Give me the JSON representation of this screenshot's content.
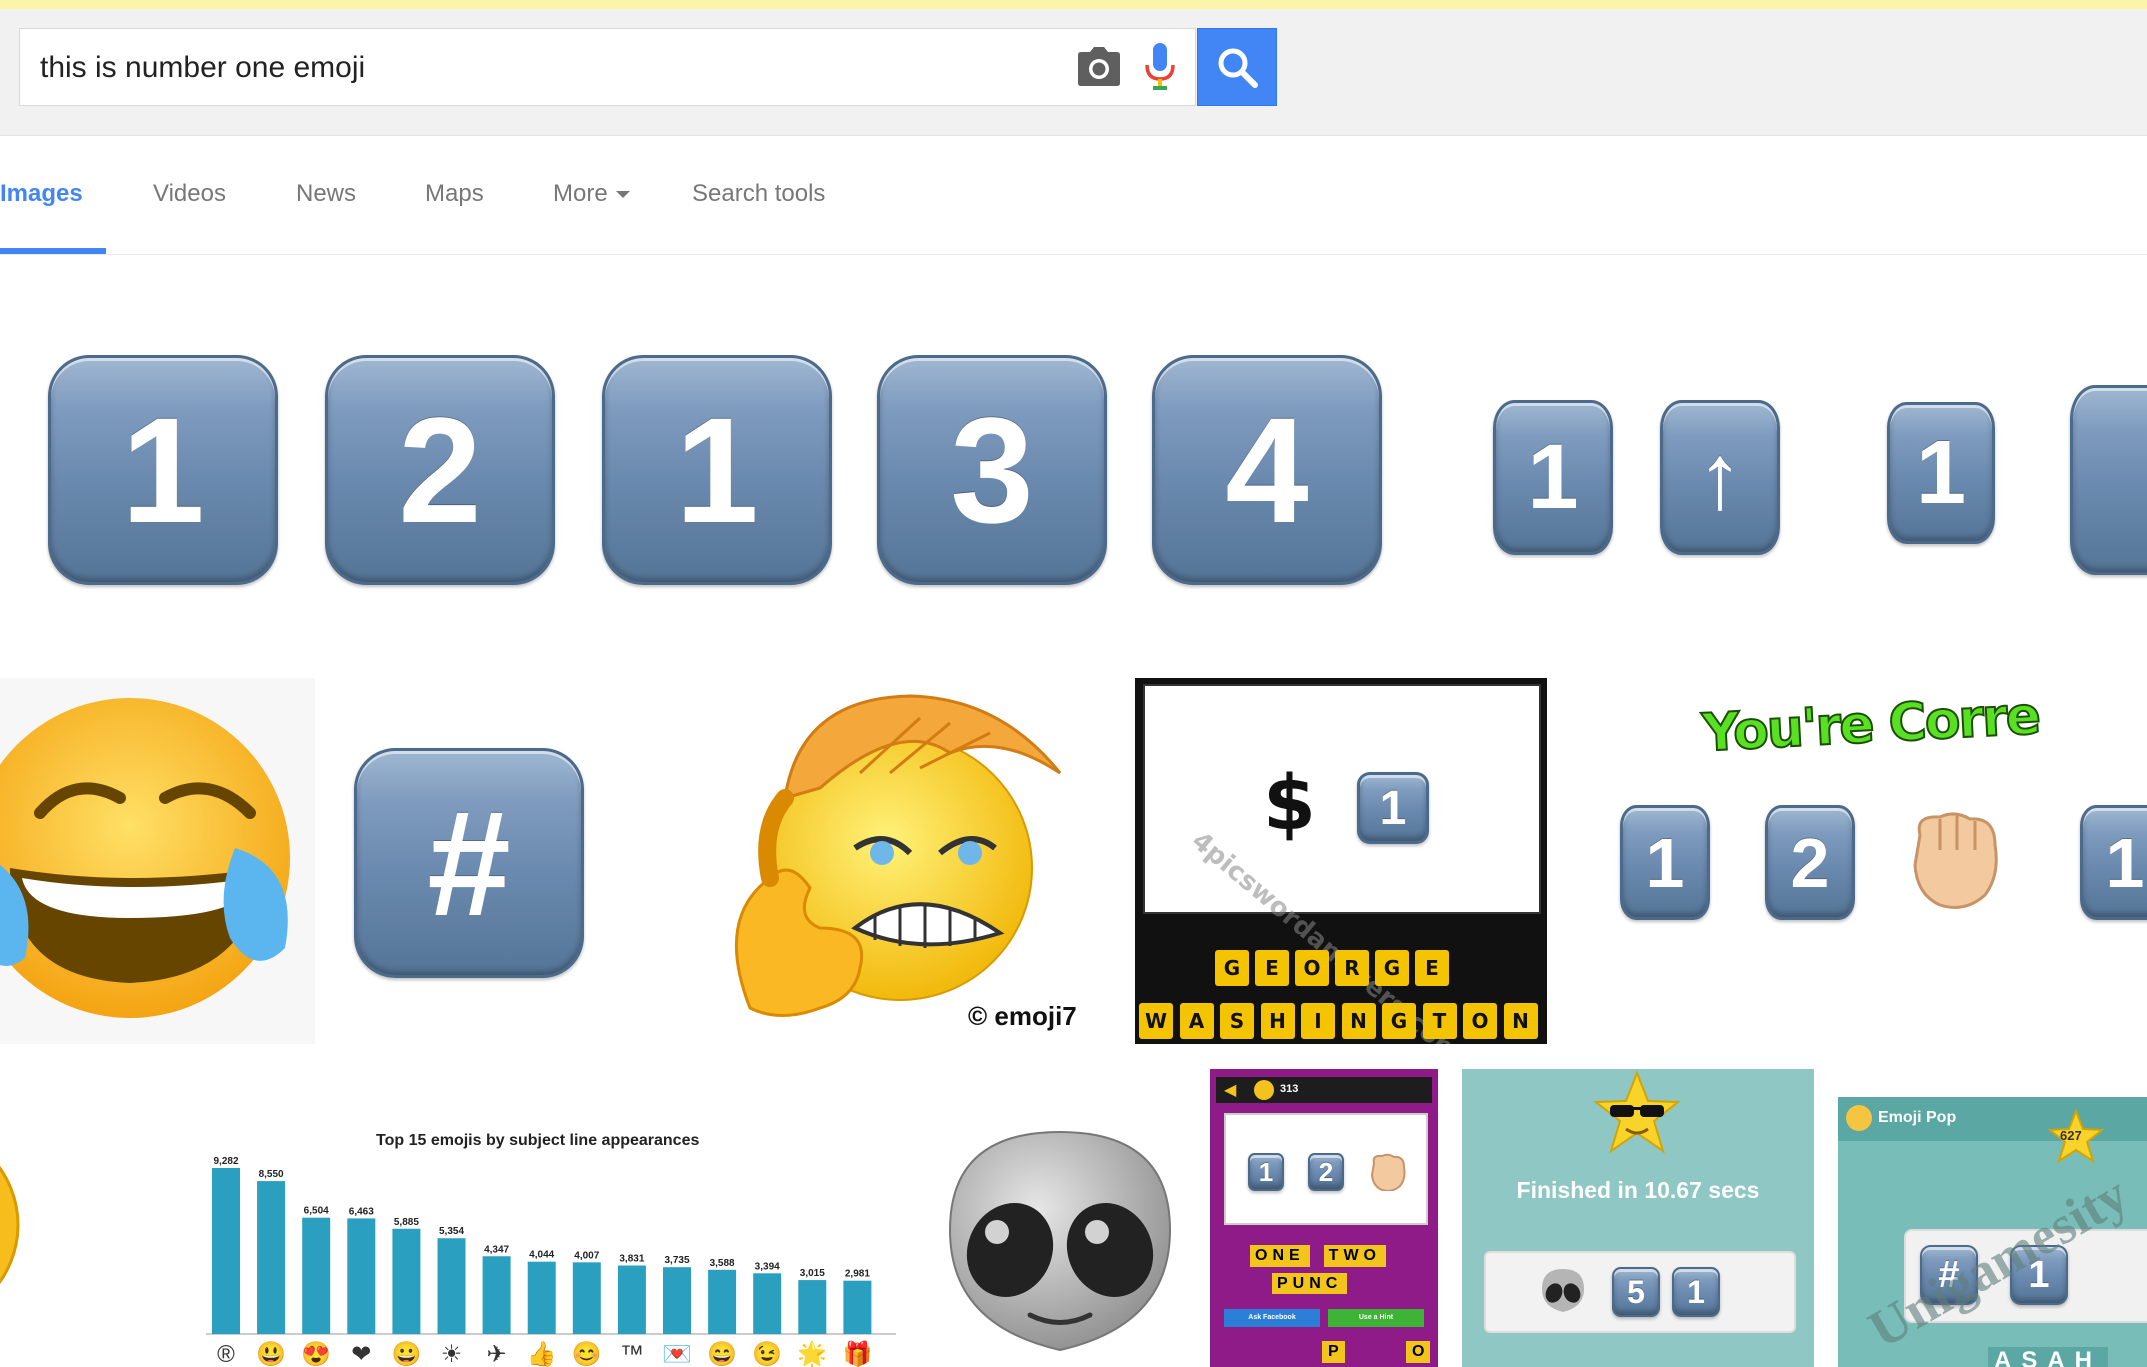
{
  "search": {
    "query": "this is number one emoji",
    "camera_icon": "camera-icon",
    "mic_icon": "microphone-icon",
    "search_icon": "magnifier-icon",
    "accent_color": "#4285f4"
  },
  "tabs": [
    {
      "label": "Images",
      "active": true
    },
    {
      "label": "Videos",
      "active": false
    },
    {
      "label": "News",
      "active": false
    },
    {
      "label": "Maps",
      "active": false
    },
    {
      "label": "More",
      "active": false,
      "has_dropdown": true
    },
    {
      "label": "Search tools",
      "active": false
    }
  ],
  "results": {
    "row1": {
      "keycaps_large": [
        "1",
        "2",
        "1",
        "3",
        "4"
      ],
      "keycaps_pair": [
        "1",
        "↑"
      ],
      "keycaps_single": [
        "1"
      ]
    },
    "row2": {
      "hashtag_keycap": "#",
      "watermark_emoji7": "© emoji7",
      "puzzle1": {
        "clue_symbol": "$",
        "clue_key": "1",
        "watermark": "4picswordanswers.com",
        "answer_row1": [
          "G",
          "E",
          "O",
          "R",
          "G",
          "E"
        ],
        "answer_row2": [
          "W",
          "A",
          "S",
          "H",
          "I",
          "N",
          "G",
          "T",
          "O",
          "N"
        ]
      },
      "puzzle2": {
        "banner": "You're Correct!",
        "keys": [
          "1",
          "2"
        ]
      },
      "edge_key": "1"
    },
    "row3": {
      "chart_title": "Top 15 emojis by subject line appearances",
      "game1": {
        "coins": "313",
        "keys": [
          "1",
          "2"
        ],
        "answer_row1": [
          "ONE",
          "TWO"
        ],
        "answer_row2": "PUNC",
        "btn_left": "Ask Facebook",
        "btn_right": "Use a Hint",
        "bottom_letters": [
          "P",
          "O"
        ]
      },
      "game2": {
        "finished_text": "Finished in 10.67 secs",
        "keys": [
          "5",
          "1"
        ]
      },
      "game3": {
        "app_title": "Emoji Pop",
        "star_count": "627",
        "keys": [
          "#",
          "1"
        ],
        "watermark": "Unigamesity",
        "bottom_letters": "ASAH"
      }
    }
  },
  "chart_data": {
    "type": "bar",
    "title": "Top 15 emojis by subject line appearances",
    "xlabel": "",
    "ylabel": "",
    "categories": [
      "®",
      "😃",
      "😍",
      "❤",
      "😀",
      "☀",
      "✈",
      "👍",
      "😊",
      "™",
      "💌",
      "😄",
      "😉",
      "🌟",
      "🎁"
    ],
    "values": [
      9282,
      8550,
      6504,
      6463,
      5885,
      5354,
      4347,
      4044,
      4007,
      3831,
      3735,
      3588,
      3394,
      3015,
      2981
    ],
    "value_labels": [
      "9,282",
      "8,550",
      "6,504",
      "6,463",
      "5,885",
      "5,354",
      "4,347",
      "4,044",
      "4,007",
      "3,831",
      "3,735",
      "3,588",
      "3,394",
      "3,015",
      "2,981"
    ],
    "ylim": [
      0,
      9282
    ],
    "bar_color": "#2b9fbf",
    "grid": false,
    "legend": "none"
  }
}
